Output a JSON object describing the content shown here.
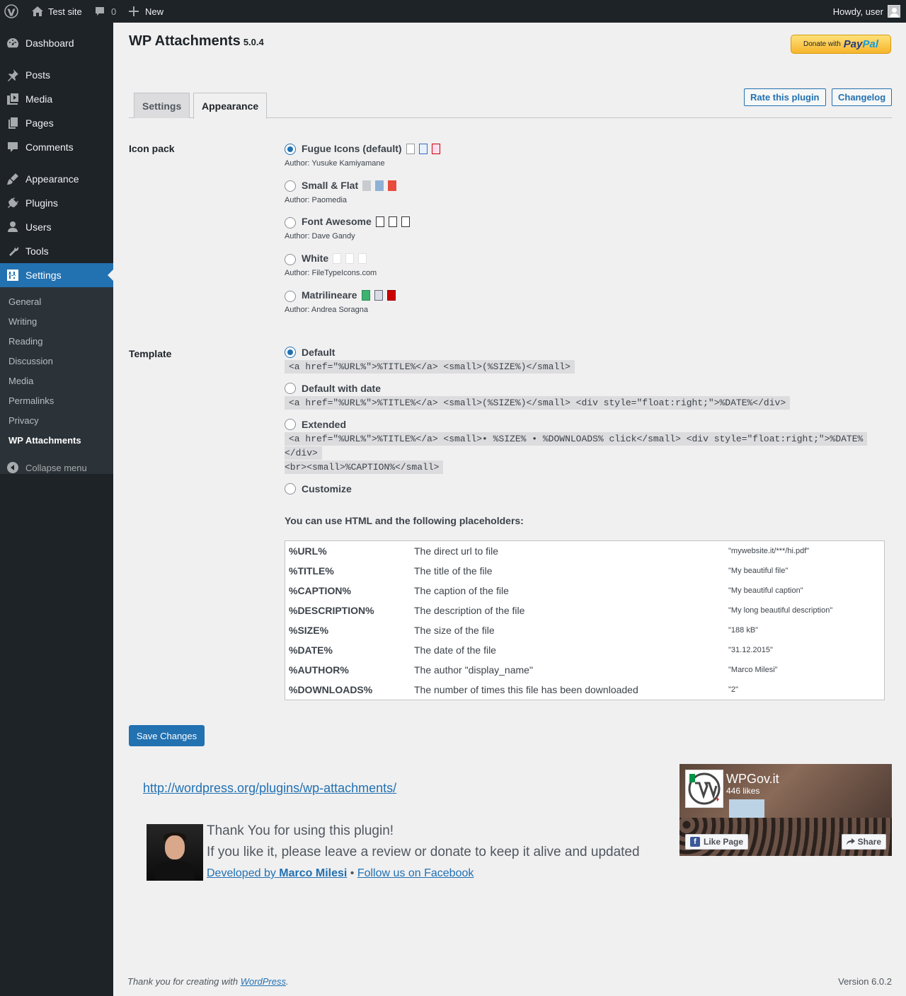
{
  "adminbar": {
    "site_name": "Test site",
    "comments_count": "0",
    "new_label": "New",
    "howdy": "Howdy, user"
  },
  "menu": {
    "items": [
      {
        "label": "Dashboard",
        "icon": "dashboard-icon"
      },
      {
        "label": "Posts",
        "icon": "pin-icon"
      },
      {
        "label": "Media",
        "icon": "media-icon"
      },
      {
        "label": "Pages",
        "icon": "page-icon"
      },
      {
        "label": "Comments",
        "icon": "comment-icon"
      },
      {
        "label": "Appearance",
        "icon": "brush-icon"
      },
      {
        "label": "Plugins",
        "icon": "plugin-icon"
      },
      {
        "label": "Users",
        "icon": "user-icon"
      },
      {
        "label": "Tools",
        "icon": "wrench-icon"
      },
      {
        "label": "Settings",
        "icon": "settings-icon"
      }
    ],
    "submenu": [
      "General",
      "Writing",
      "Reading",
      "Discussion",
      "Media",
      "Permalinks",
      "Privacy",
      "WP Attachments"
    ],
    "collapse": "Collapse menu"
  },
  "page": {
    "title": "WP Attachments",
    "version": "5.0.4",
    "donate_prefix": "Donate with",
    "donate_brand_a": "Pay",
    "donate_brand_b": "Pal",
    "tabs": [
      "Settings",
      "Appearance"
    ],
    "rate_button": "Rate this plugin",
    "changelog_button": "Changelog"
  },
  "iconpack": {
    "heading": "Icon pack",
    "options": [
      {
        "label": "Fugue Icons (default)",
        "author": "Author: Yusuke Kamiyamane",
        "checked": true
      },
      {
        "label": "Small & Flat",
        "author": "Author: Paomedia",
        "checked": false
      },
      {
        "label": "Font Awesome",
        "author": "Author: Dave Gandy",
        "checked": false
      },
      {
        "label": "White",
        "author": "Author: FileTypeIcons.com",
        "checked": false
      },
      {
        "label": "Matrilineare",
        "author": "Author: Andrea Soragna",
        "checked": false
      }
    ]
  },
  "template": {
    "heading": "Template",
    "options": [
      {
        "label": "Default",
        "code": "<a href=\"%URL%\">%TITLE%</a> <small>(%SIZE%)</small>",
        "checked": true
      },
      {
        "label": "Default with date",
        "code": "<a href=\"%URL%\">%TITLE%</a> <small>(%SIZE%)</small> <div style=\"float:right;\">%DATE%</div>",
        "checked": false
      },
      {
        "label": "Extended",
        "code_line1": "<a href=\"%URL%\">%TITLE%</a> <small>• %SIZE% • %DOWNLOADS% click</small> <div style=\"float:right;\">%DATE%",
        "code_line2": "</div>",
        "code_line3": "<br><small>%CAPTION%</small>",
        "checked": false
      },
      {
        "label": "Customize",
        "checked": false
      }
    ],
    "placeholders_title": "You can use HTML and the following placeholders:",
    "placeholders": [
      {
        "key": "%URL%",
        "desc": "The direct url to file",
        "example": "\"mywebsite.it/***/hi.pdf\""
      },
      {
        "key": "%TITLE%",
        "desc": "The title of the file",
        "example": "\"My beautiful file\""
      },
      {
        "key": "%CAPTION%",
        "desc": "The caption of the file",
        "example": "\"My beautiful caption\""
      },
      {
        "key": "%DESCRIPTION%",
        "desc": "The description of the file",
        "example": "\"My long beautiful description\""
      },
      {
        "key": "%SIZE%",
        "desc": "The size of the file",
        "example": "\"188 kB\""
      },
      {
        "key": "%DATE%",
        "desc": "The date of the file",
        "example": "\"31.12.2015\""
      },
      {
        "key": "%AUTHOR%",
        "desc": "The author \"display_name\"",
        "example": "\"Marco Milesi\""
      },
      {
        "key": "%DOWNLOADS%",
        "desc": "The number of times this file has been downloaded",
        "example": "\"2\""
      }
    ]
  },
  "save_button": "Save Changes",
  "promo": {
    "plugin_link": "http://wordpress.org/plugins/wp-attachments/",
    "thanks_line1": "Thank You for using this plugin!",
    "thanks_line2": "If you like it, please leave a review or donate to keep it alive and updated",
    "dev_prefix": "Developed by ",
    "dev_name": "Marco Milesi",
    "separator": " • ",
    "facebook_link": "Follow us on Facebook"
  },
  "facebook": {
    "page_name": "WPGov.it",
    "likes": "446 likes",
    "like_button": "Like Page",
    "share_button": "Share"
  },
  "footer": {
    "thanks_prefix": "Thank you for creating with ",
    "wordpress_link": "WordPress",
    "thanks_suffix": ".",
    "version": "Version 6.0.2"
  }
}
